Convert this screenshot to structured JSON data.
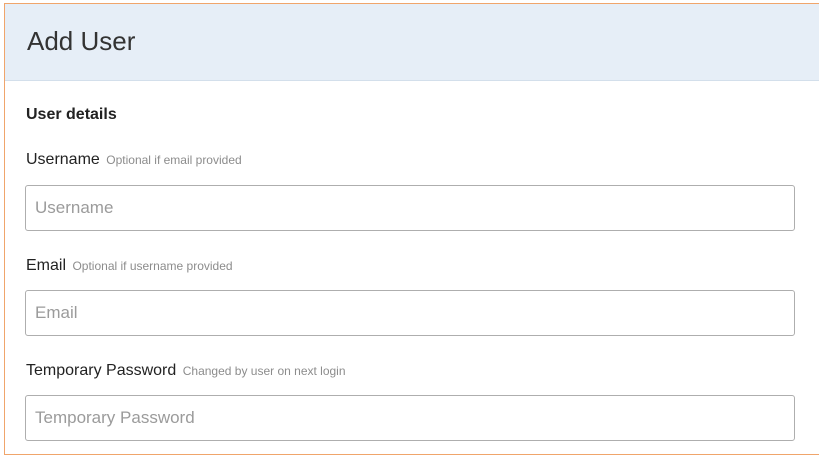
{
  "header": {
    "title": "Add User"
  },
  "form": {
    "section_title": "User details",
    "username": {
      "label": "Username",
      "hint": "Optional if email provided",
      "placeholder": "Username",
      "value": ""
    },
    "email": {
      "label": "Email",
      "hint": "Optional if username provided",
      "placeholder": "Email",
      "value": ""
    },
    "temp_password": {
      "label": "Temporary Password",
      "hint": "Changed by user on next login",
      "placeholder": "Temporary Password",
      "value": ""
    }
  },
  "colors": {
    "panel_border": "#f0a56b",
    "header_background": "#e6eef7",
    "input_border": "#aeaeae",
    "hint_text": "#8c8c8c"
  }
}
